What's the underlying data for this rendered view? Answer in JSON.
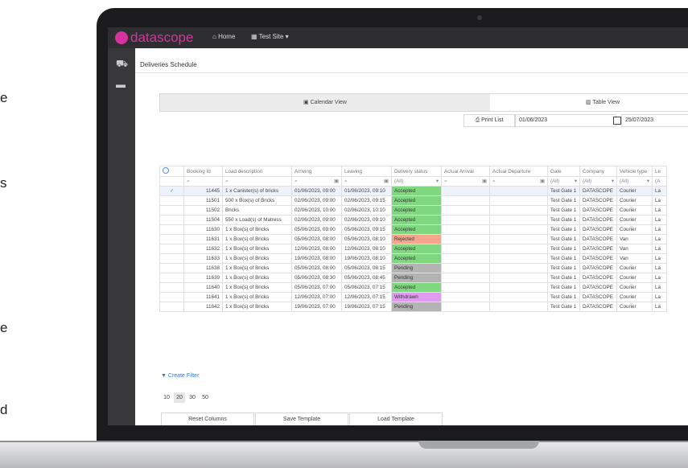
{
  "left_text": [
    "e",
    "s",
    "e",
    "d"
  ],
  "topbar": {
    "brand": "datascope",
    "nav_home": "Home",
    "nav_site": "Test Site"
  },
  "page": {
    "title": "Deliveries Schedule"
  },
  "views": {
    "calendar": "Calendar View",
    "table": "Table View"
  },
  "filters": {
    "print_label": "Print List",
    "date_from": "01/06/2023",
    "date_to": "25/07/2023"
  },
  "table": {
    "columns": [
      "",
      "Booking Id",
      "Load description",
      "Arriving",
      "Leaving",
      "Delivery status",
      "Actual Arrival",
      "Actual Departure",
      "Gate",
      "Company",
      "Vehicle type",
      "Le"
    ],
    "filter_row": [
      "",
      "",
      "",
      "",
      "",
      "(All)",
      "",
      "",
      "(All)",
      "(All)",
      "(All)",
      "(A"
    ],
    "rows": [
      {
        "id": "11445",
        "load": "1 x Canister(s) of bricks",
        "arriving": "01/06/2023, 09:00",
        "leaving": "01/06/2023, 09:10",
        "status": "Accepted",
        "gate": "Test Gate 1",
        "company": "DATASCOPE",
        "vehicle": "Courier",
        "le": "La"
      },
      {
        "id": "11501",
        "load": "500 x Box(s) of Bricks",
        "arriving": "02/06/2023, 09:00",
        "leaving": "02/06/2023, 09:15",
        "status": "Accepted",
        "gate": "Test Gate 1",
        "company": "DATASCOPE",
        "vehicle": "Courier",
        "le": "La"
      },
      {
        "id": "11502",
        "load": "Bricks",
        "arriving": "02/06/2023, 10:00",
        "leaving": "02/06/2023, 10:10",
        "status": "Accepted",
        "gate": "Test Gate 1",
        "company": "DATASCOPE",
        "vehicle": "Courier",
        "le": "La"
      },
      {
        "id": "11504",
        "load": "550 x Load(s) of Matress",
        "arriving": "02/06/2023, 09:00",
        "leaving": "02/06/2023, 09:10",
        "status": "Accepted",
        "gate": "Test Gate 1",
        "company": "DATASCOPE",
        "vehicle": "Courier",
        "le": "La"
      },
      {
        "id": "11630",
        "load": "1 x Box(s) of Bricks",
        "arriving": "05/06/2023, 09:00",
        "leaving": "05/06/2023, 09:15",
        "status": "Accepted",
        "gate": "Test Gate 1",
        "company": "DATASCOPE",
        "vehicle": "Courier",
        "le": "La"
      },
      {
        "id": "11631",
        "load": "1 x Box(s) of Bricks",
        "arriving": "05/06/2023, 08:00",
        "leaving": "05/06/2023, 08:10",
        "status": "Rejected",
        "gate": "Test Gate 1",
        "company": "DATASCOPE",
        "vehicle": "Van",
        "le": "La"
      },
      {
        "id": "11632",
        "load": "1 x Box(s) of Bricks",
        "arriving": "12/06/2023, 08:00",
        "leaving": "12/06/2023, 08:10",
        "status": "Accepted",
        "gate": "Test Gate 1",
        "company": "DATASCOPE",
        "vehicle": "Van",
        "le": "La"
      },
      {
        "id": "11633",
        "load": "1 x Box(s) of Bricks",
        "arriving": "19/06/2023, 08:00",
        "leaving": "19/06/2023, 08:10",
        "status": "Accepted",
        "gate": "Test Gate 1",
        "company": "DATASCOPE",
        "vehicle": "Van",
        "le": "La"
      },
      {
        "id": "11638",
        "load": "1 x Box(s) of Bricks",
        "arriving": "05/06/2023, 08:00",
        "leaving": "05/06/2023, 08:15",
        "status": "Pending",
        "gate": "Test Gate 1",
        "company": "DATASCOPE",
        "vehicle": "Courier",
        "le": "La"
      },
      {
        "id": "11639",
        "load": "1 x Box(s) of Bricks",
        "arriving": "05/06/2023, 08:30",
        "leaving": "05/06/2023, 08:45",
        "status": "Pending",
        "gate": "Test Gate 1",
        "company": "DATASCOPE",
        "vehicle": "Courier",
        "le": "La"
      },
      {
        "id": "11640",
        "load": "1 x Box(s) of Bricks",
        "arriving": "05/06/2023, 07:00",
        "leaving": "05/06/2023, 07:15",
        "status": "Accepted",
        "gate": "Test Gate 1",
        "company": "DATASCOPE",
        "vehicle": "Courier",
        "le": "La"
      },
      {
        "id": "11641",
        "load": "1 x Box(s) of Bricks",
        "arriving": "12/06/2023, 07:00",
        "leaving": "12/06/2023, 07:15",
        "status": "Withdrawn",
        "gate": "Test Gate 1",
        "company": "DATASCOPE",
        "vehicle": "Courier",
        "le": "La"
      },
      {
        "id": "11642",
        "load": "1 x Box(s) of Bricks",
        "arriving": "19/06/2023, 07:00",
        "leaving": "19/06/2023, 07:15",
        "status": "Pending",
        "gate": "Test Gate 1",
        "company": "DATASCOPE",
        "vehicle": "Courier",
        "le": "La"
      }
    ]
  },
  "status_colors": {
    "Accepted": "#7fd87f",
    "Rejected": "#f7a58c",
    "Pending": "#b3b3b3",
    "Withdrawn": "#e09af2"
  },
  "create_filter": "Create Filter",
  "pager": [
    "10",
    "20",
    "30",
    "50"
  ],
  "pager_active": "20",
  "buttons": {
    "reset": "Reset Columns",
    "save": "Save Template",
    "load": "Load Template"
  },
  "colors": {
    "brand": "#d6339e",
    "link": "#2f78c4",
    "topbar": "#2e2e31"
  }
}
